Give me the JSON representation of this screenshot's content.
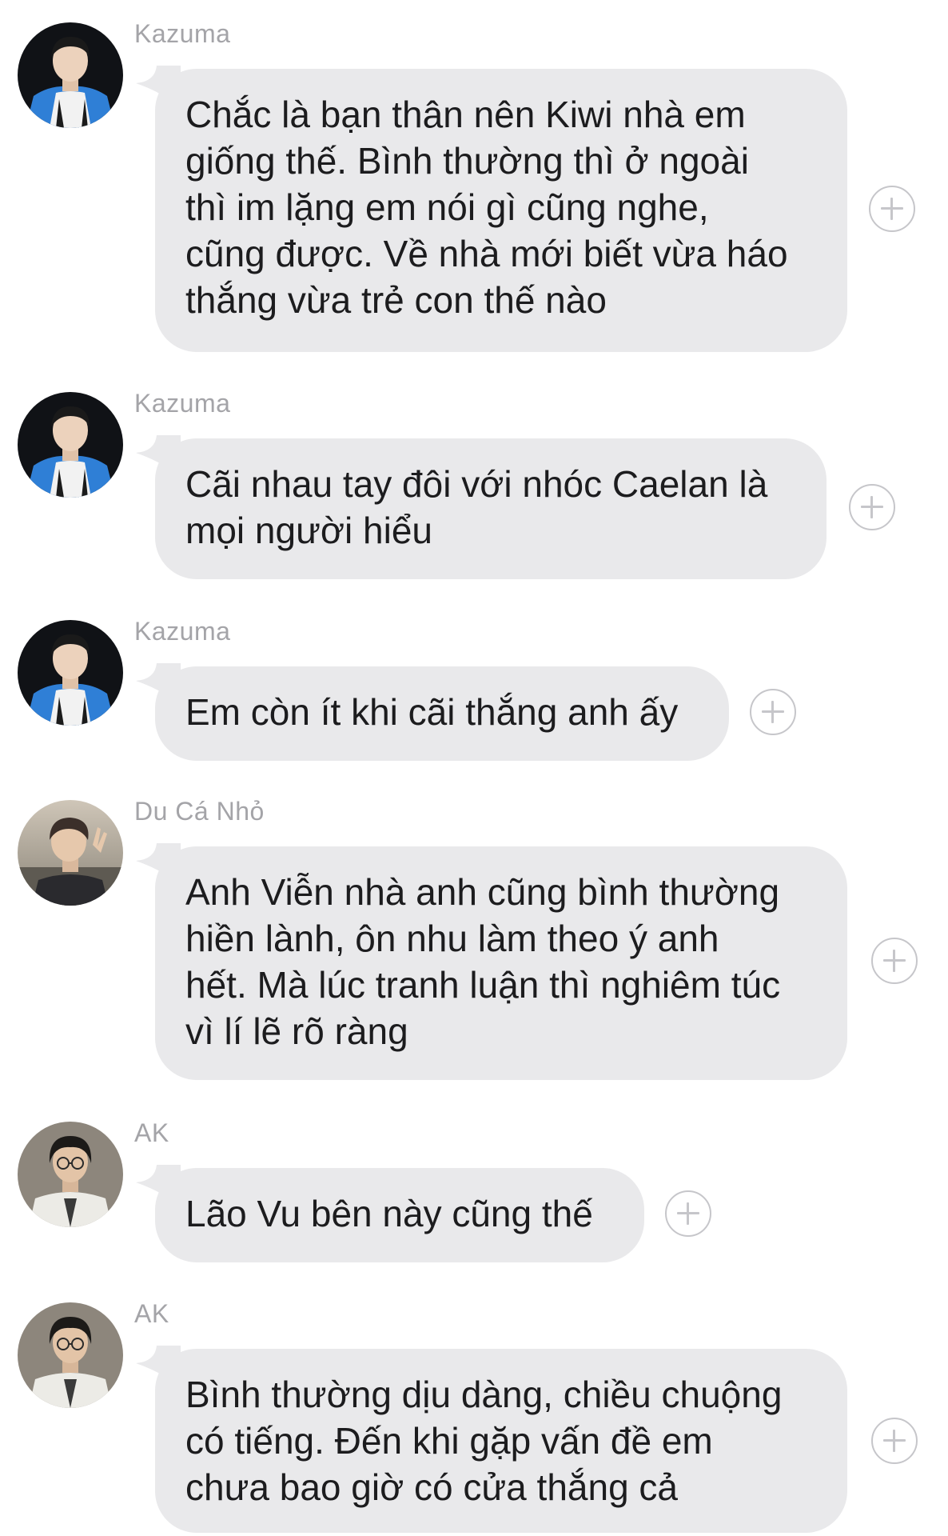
{
  "messages": [
    {
      "sender": "Kazuma",
      "avatar": "kazuma-avatar",
      "lines": [
        "Chắc là bạn thân nên Kiwi nhà em",
        "giống thế. Bình thường thì ở ngoài",
        "thì im lặng em nói gì cũng nghe,",
        "cũng được. Về nhà mới biết vừa háo",
        "thắng vừa trẻ con thế nào"
      ]
    },
    {
      "sender": "Kazuma",
      "avatar": "kazuma-avatar",
      "lines": [
        "Cãi nhau tay đôi với nhóc Caelan là",
        "mọi người hiểu"
      ]
    },
    {
      "sender": "Kazuma",
      "avatar": "kazuma-avatar",
      "lines": [
        "Em còn ít khi cãi thắng anh ấy"
      ]
    },
    {
      "sender": "Du Cá Nhỏ",
      "avatar": "du-ca-nho-avatar",
      "lines": [
        "Anh Viễn nhà anh cũng bình thường",
        "hiền lành, ôn nhu làm theo ý anh",
        "hết. Mà lúc tranh luận thì nghiêm túc",
        "vì lí lẽ rõ ràng"
      ]
    },
    {
      "sender": "AK",
      "avatar": "ak-avatar",
      "lines": [
        "Lão Vu bên này cũng thế"
      ]
    },
    {
      "sender": "AK",
      "avatar": "ak-avatar",
      "lines": [
        "Bình thường dịu dàng, chiều chuộng",
        "có tiếng. Đến khi gặp vấn đề em",
        "chưa bao giờ có cửa thắng cả"
      ]
    }
  ],
  "add_reaction_icon": "plus-circle-icon",
  "colors": {
    "bubble": "#e9e9eb",
    "sender_name": "#a4a4a8",
    "text": "#1c1c1e",
    "add_icon": "#c6c6ca"
  }
}
